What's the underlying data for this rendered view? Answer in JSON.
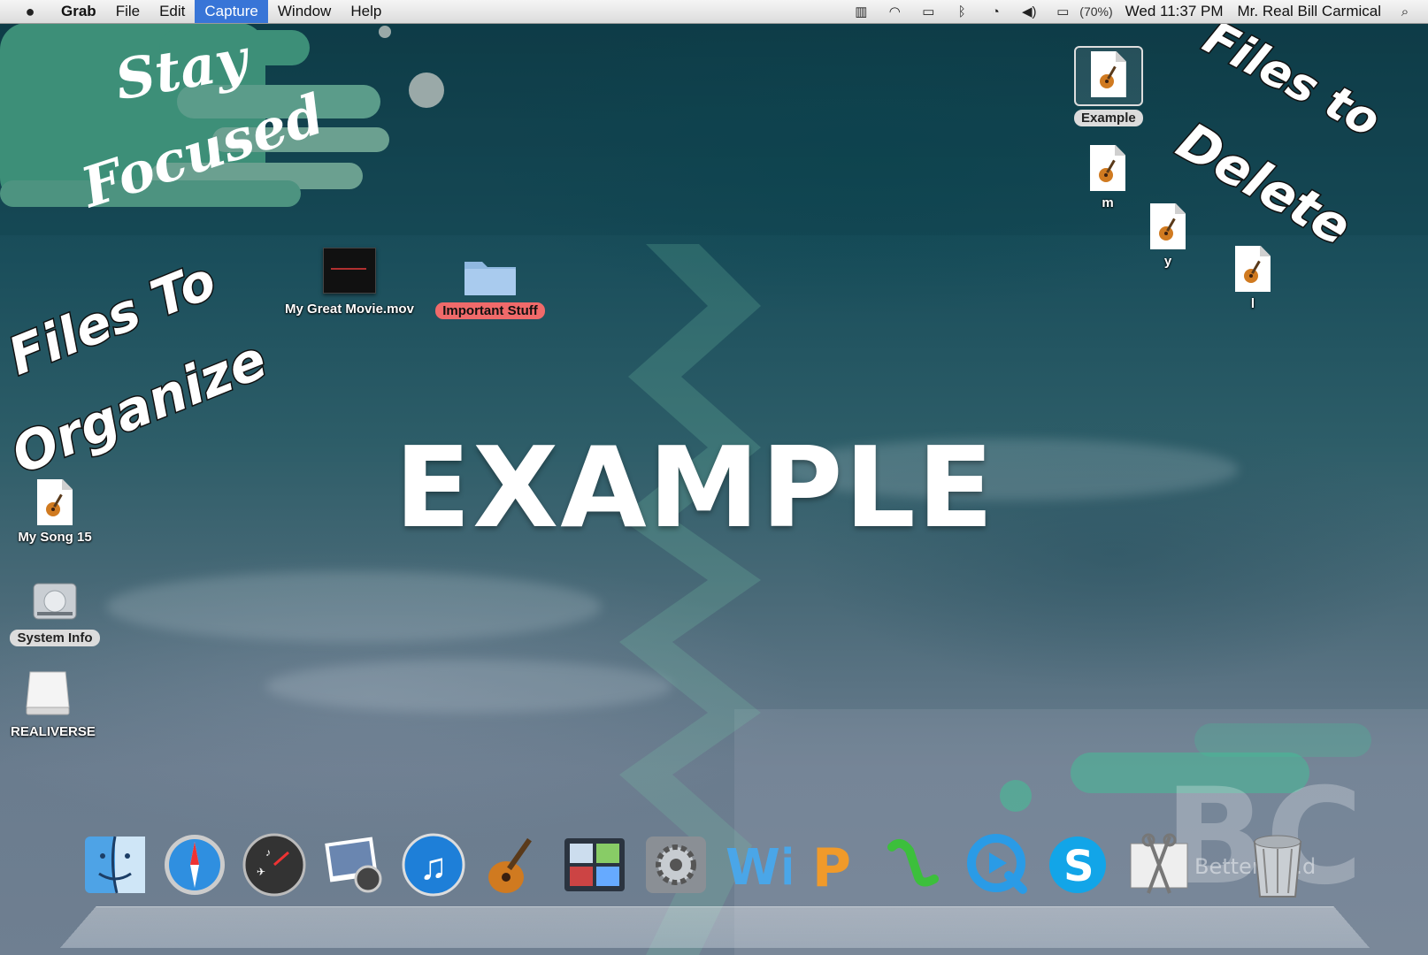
{
  "menubar": {
    "app_name": "Grab",
    "menus": [
      "File",
      "Edit",
      "Capture",
      "Window",
      "Help"
    ],
    "active_menu": "Capture",
    "battery_percent": "(70%)",
    "clock": "Wed 11:37 PM",
    "user": "Mr. Real Bill Carmical"
  },
  "wallpaper": {
    "stay_focused_line1": "Stay",
    "stay_focused_line2": "Focused",
    "files_to_organize_line1": "Files To",
    "files_to_organize_line2": "Organize",
    "files_to_delete_line1": "Files to",
    "files_to_delete_line2": "Delete",
    "watermark": "EXAMPLE",
    "logo_text": "BC",
    "logo_subtitle": "Better C...d"
  },
  "desktop_icons": [
    {
      "label": "Example",
      "type": "song"
    },
    {
      "label": "m",
      "type": "song"
    },
    {
      "label": "y",
      "type": "song"
    },
    {
      "label": "l",
      "type": "song"
    },
    {
      "label": "My Great Movie.mov",
      "type": "movie"
    },
    {
      "label": "Important Stuff",
      "type": "folder"
    },
    {
      "label": "My Song 15",
      "type": "song"
    },
    {
      "label": "System Info",
      "type": "disk"
    },
    {
      "label": "REALIVERSE",
      "type": "drive"
    }
  ],
  "dock": [
    "finder-icon",
    "safari-icon",
    "dashboard-icon",
    "iphoto-icon",
    "itunes-icon",
    "garageband-icon",
    "spaces-icon",
    "system-preferences-icon",
    "iweb-icon",
    "pages-icon",
    "numbers-icon",
    "quicktime-icon",
    "skype-icon",
    "grab-icon",
    "trash-icon"
  ],
  "colors": {
    "menu_highlight": "#3875d7",
    "label_red": "#f06a6a",
    "banner_green": "#3d8f78"
  }
}
